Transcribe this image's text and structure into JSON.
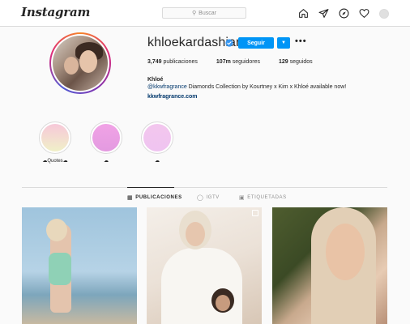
{
  "header": {
    "logo": "Instagram",
    "search_placeholder": "Buscar",
    "icons": [
      "home-icon",
      "direct-icon",
      "explore-icon",
      "activity-heart-icon",
      "profile-avatar-icon"
    ]
  },
  "profile": {
    "username": "khloekardashian",
    "verified": true,
    "follow_label": "Seguir",
    "dropdown_icon": "chevron-down-icon",
    "more_icon": "more-options-icon",
    "stats": {
      "posts_count": "3,749",
      "posts_label": " publicaciones",
      "followers_count": "107m",
      "followers_label": " seguidores",
      "following_count": "129",
      "following_label": " seguidos"
    },
    "full_name": "Khloé",
    "bio_mention": "@kkwfragrance",
    "bio_text": " Diamonds Collection by Kourtney x Kim x Khloé available now!",
    "bio_link": "kkwfragrance.com"
  },
  "highlights": [
    {
      "label": "☁Quotes☁",
      "color_top": "#f7c8d9",
      "color_bottom": "#f0f0c8"
    },
    {
      "label": "☁",
      "color_top": "#f1a3e6",
      "color_bottom": "#e39ae0"
    },
    {
      "label": "☁",
      "color_top": "#f3c6ee",
      "color_bottom": "#efc4f0"
    }
  ],
  "tabs": [
    {
      "label": "PUBLICACIONES",
      "icon": "grid-icon",
      "active": true
    },
    {
      "label": "IGTV",
      "icon": "igtv-icon",
      "active": false
    },
    {
      "label": "ETIQUETADAS",
      "icon": "tagged-icon",
      "active": false
    }
  ],
  "colors": {
    "accent": "#0095f6",
    "link": "#00376b",
    "border": "#dbdbdb"
  }
}
